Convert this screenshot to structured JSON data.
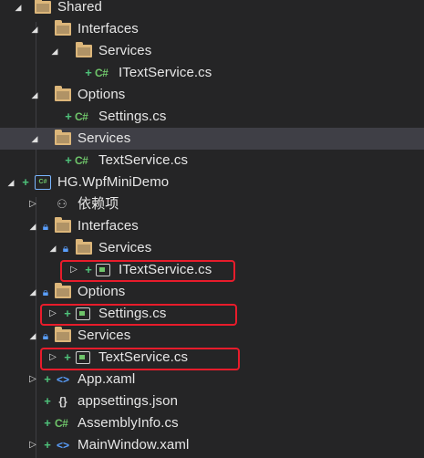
{
  "tree": {
    "shared": "Shared",
    "shared_interfaces": "Interfaces",
    "shared_interfaces_services": "Services",
    "itextservice_file": "ITextService.cs",
    "shared_options": "Options",
    "settings_file": "Settings.cs",
    "shared_services": "Services",
    "textservice_file": "TextService.cs",
    "project": "HG.WpfMiniDemo",
    "dependencies": "依赖项",
    "proj_interfaces": "Interfaces",
    "proj_interfaces_services": "Services",
    "linked_itextservice": "ITextService.cs",
    "proj_options": "Options",
    "linked_settings": "Settings.cs",
    "proj_services": "Services",
    "linked_textservice": "TextService.cs",
    "app_xaml": "App.xaml",
    "appsettings": "appsettings.json",
    "assemblyinfo": "AssemblyInfo.cs",
    "mainwindow": "MainWindow.xaml"
  },
  "icons": {
    "cs_glyph": "C#",
    "plus_glyph": "+",
    "lock_glyph": "🔒",
    "expanded_glyph": "◢",
    "collapsed_glyph": "▷"
  },
  "colors": {
    "background": "#252526",
    "selected_row": "#3f3f46",
    "folder": "#dcb67a",
    "csharp": "#6fc46a",
    "highlight_box": "#e81c2b",
    "lock": "#5aa0ff"
  }
}
